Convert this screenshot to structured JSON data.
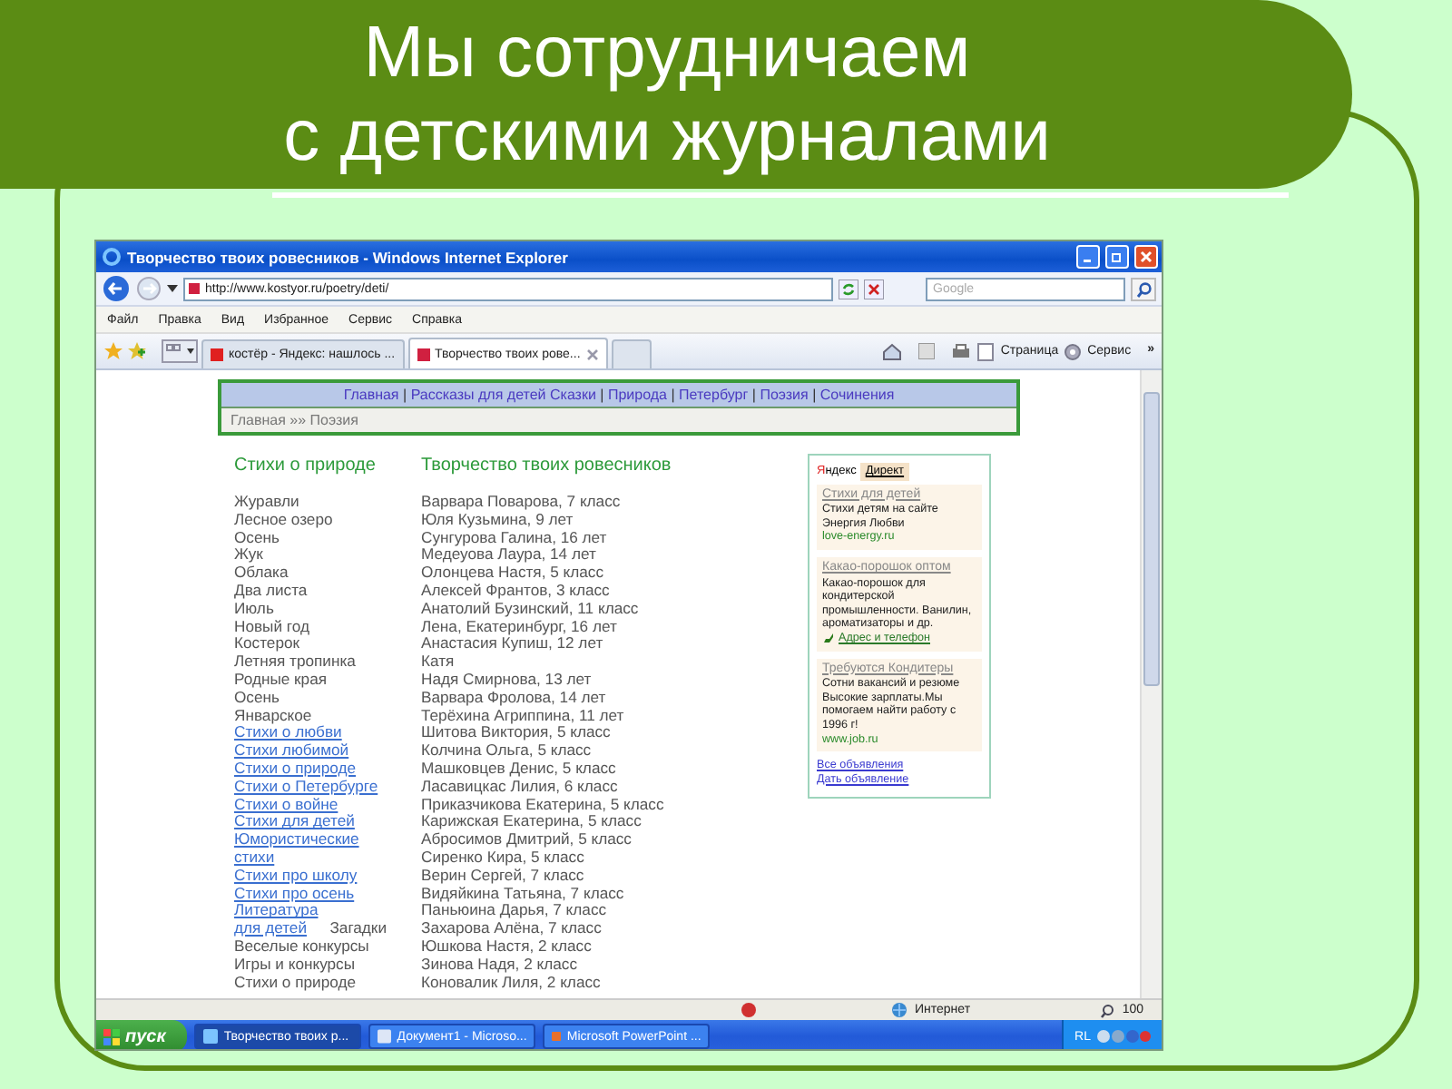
{
  "slide": {
    "title_lines": [
      "Мы сотрудничаем",
      "с детскими журналами"
    ]
  },
  "browser": {
    "title": "Творчество твоих ровесников - Windows Internet Explorer",
    "address": "http://www.kostyor.ru/poetry/deti/",
    "search_placeholder": "Google",
    "menu": [
      "Файл",
      "Правка",
      "Вид",
      "Избранное",
      "Сервис",
      "Справка"
    ],
    "tabs": [
      {
        "label": "костёр - Яндекс: нашлось ...",
        "selected": false
      },
      {
        "label": "Творчество твоих рове...",
        "selected": true
      }
    ],
    "toolbar": [
      "Страница",
      "Сервис"
    ],
    "chevron": "»"
  },
  "page": {
    "nav": [
      {
        "kind": "link",
        "text": "Главная"
      },
      {
        "kind": "sep",
        "text": "|"
      },
      {
        "kind": "link",
        "text": "Рассказы для детей"
      },
      {
        "kind": "link",
        "text": "Сказки"
      },
      {
        "kind": "sep",
        "text": "|"
      },
      {
        "kind": "link",
        "text": "Природа"
      },
      {
        "kind": "sep",
        "text": "|"
      },
      {
        "kind": "link",
        "text": "Петербург"
      },
      {
        "kind": "sep",
        "text": "|"
      },
      {
        "kind": "link",
        "text": "Поэзия"
      },
      {
        "kind": "sep",
        "text": "|"
      },
      {
        "kind": "link",
        "text": "Сочинения"
      }
    ],
    "breadcrumb": "Главная »» Поэзия",
    "headings": [
      "Стихи о природе",
      "Творчество твоих ровесников"
    ],
    "poems": [
      {
        "kind": "text",
        "text": "Журавли",
        "same_line": false
      },
      {
        "kind": "text",
        "text": "Лесное озеро",
        "same_line": false
      },
      {
        "kind": "text",
        "text": "Осень",
        "same_line": false
      },
      {
        "kind": "text",
        "text": "Жук",
        "same_line": false
      },
      {
        "kind": "text",
        "text": "Облака",
        "same_line": false
      },
      {
        "kind": "text",
        "text": "Два листа",
        "same_line": false
      },
      {
        "kind": "text",
        "text": "Июль",
        "same_line": false
      },
      {
        "kind": "text",
        "text": "Новый год",
        "same_line": false
      },
      {
        "kind": "text",
        "text": "Костерок",
        "same_line": false
      },
      {
        "kind": "text",
        "text": "Летняя тропинка",
        "same_line": false
      },
      {
        "kind": "text",
        "text": "Родные края",
        "same_line": false
      },
      {
        "kind": "text",
        "text": "Осень",
        "same_line": false
      },
      {
        "kind": "text",
        "text": "Январское",
        "same_line": false
      },
      {
        "kind": "link",
        "text": "Стихи о любви",
        "same_line": false
      },
      {
        "kind": "link",
        "text": "Стихи любимой",
        "same_line": false
      },
      {
        "kind": "link",
        "text": "Стихи о природе",
        "same_line": false
      },
      {
        "kind": "link",
        "text": "Стихи о Петербурге",
        "same_line": false
      },
      {
        "kind": "link",
        "text": "Стихи о войне",
        "same_line": false
      },
      {
        "kind": "link",
        "text": "Стихи для детей",
        "same_line": false
      },
      {
        "kind": "link",
        "text": "Юмористические стихи",
        "same_line": false
      },
      {
        "kind": "link",
        "text": "Стихи про школу",
        "same_line": false
      },
      {
        "kind": "link",
        "text": "Стихи про осень",
        "same_line": false
      },
      {
        "kind": "link",
        "text": "Литература для детей",
        "same_line": false
      },
      {
        "kind": "text",
        "text": "Загадки",
        "same_line": true
      },
      {
        "kind": "text",
        "text": "Веселые конкурсы",
        "same_line": false
      },
      {
        "kind": "text",
        "text": "Игры и конкурсы",
        "same_line": false
      },
      {
        "kind": "text",
        "text": "Стихи о природе",
        "same_line": false
      }
    ],
    "authors": [
      "Варвара Поварова, 7 класс",
      "Юля Кузьмина, 9 лет",
      "Сунгурова Галина, 16 лет",
      "Медеуова Лаура, 14 лет",
      "Олонцева Настя, 5 класс",
      "Алексей Франтов, 3 класс",
      "Анатолий Бузинский, 11 класс",
      "Лена, Екатеринбург, 16 лет",
      "Анастасия Купиш, 12 лет",
      "Катя",
      "Надя Смирнова, 13 лет",
      "Варвара Фролова, 14 лет",
      "Терёхина Агриппина, 11 лет",
      "Шитова Виктория, 5 класс",
      "Колчина Ольга, 5 класс",
      "Машковцев Денис, 5 класс",
      "Ласавицкас Лилия, 6 класс",
      "Приказчикова Екатерина, 5 класс",
      "Карижская Екатерина, 5 класс",
      "Абросимов Дмитрий, 5 класс",
      "Сиренко Кира, 5 класс",
      "Верин Сергей, 7 класс",
      "Видяйкина Татьяна, 7 класс",
      "Паньюина Дарья, 7 класс",
      "Захарова Алёна, 7 класс",
      "Юшкова Настя, 2 класс",
      "Зинова Надя, 2 класс",
      "Коновалик Лиля, 2 класс"
    ],
    "ads": {
      "logo": "Яндекс",
      "tab": "Директ",
      "items": [
        {
          "title": "Стихи для детей",
          "body": "Стихи детям на сайте Энергия Любви",
          "url": "love-energy.ru"
        },
        {
          "title": "Какао-порошок оптом",
          "body": "Какао-порошок для кондитерской промышленности. Ванилин, ароматизаторы и др.",
          "link": "Адрес и телефон"
        },
        {
          "title": "Требуются Кондитеры",
          "body": "Сотни вакансий и резюме Высокие зарплаты.Мы помогаем найти работу с 1996 г!",
          "url": "www.job.ru"
        }
      ],
      "footer_links": [
        "Все объявления",
        "Дать объявление"
      ]
    }
  },
  "status_bar": {
    "zone": "Интернет",
    "zoom": "100"
  },
  "taskbar": {
    "start": "пуск",
    "tasks": [
      {
        "label": "Творчество твоих р...",
        "selected": true
      },
      {
        "label": "Документ1 - Microso...",
        "selected": false
      },
      {
        "label": "Microsoft PowerPoint ...",
        "selected": false
      }
    ],
    "tray": "RL"
  }
}
